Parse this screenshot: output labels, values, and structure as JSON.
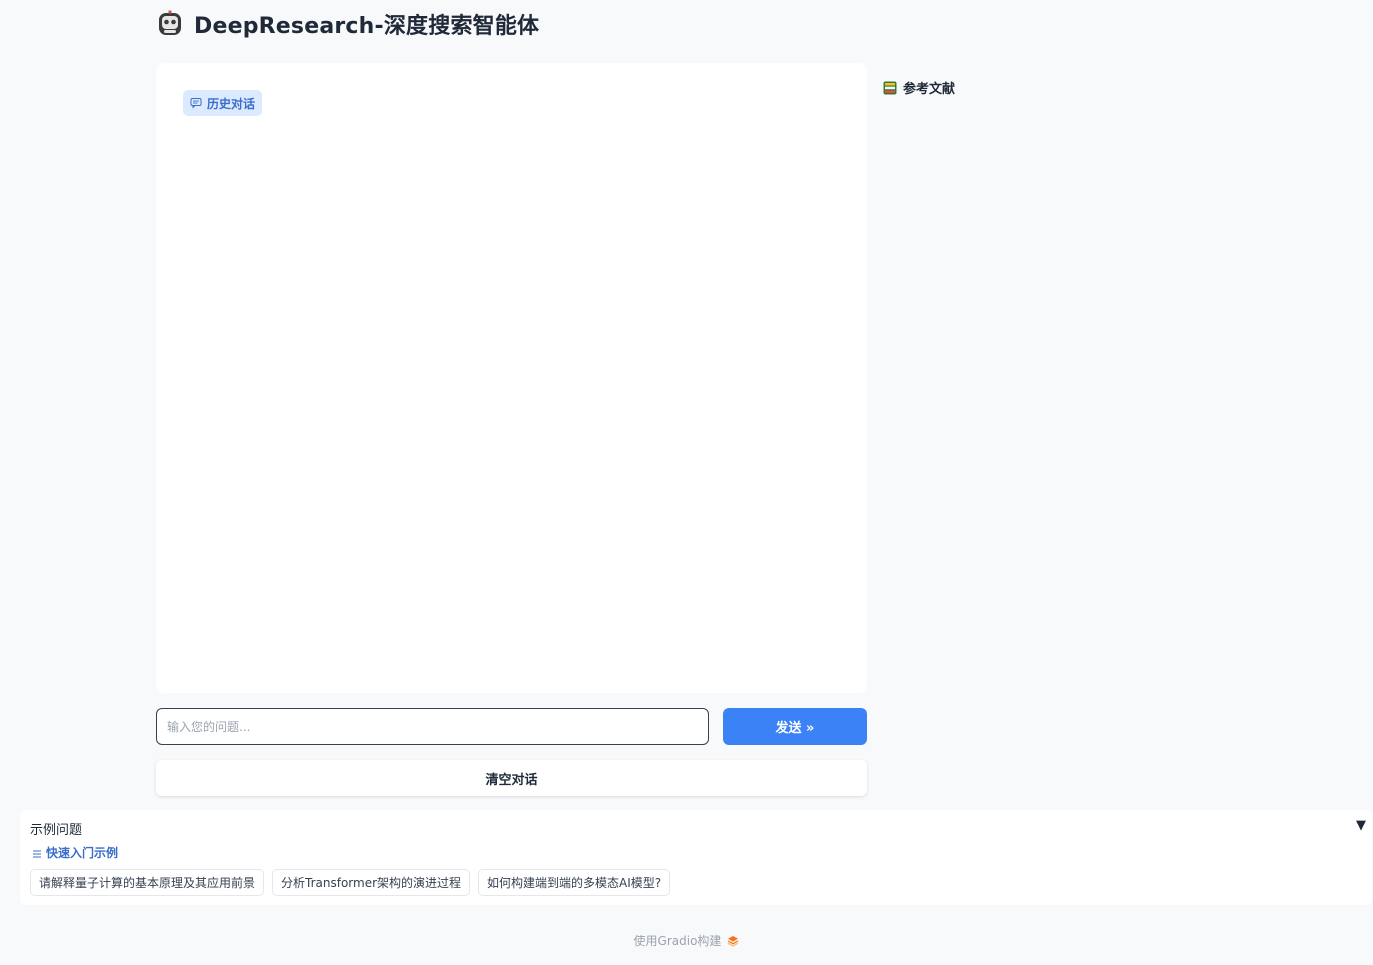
{
  "header": {
    "title": "DeepResearch-深度搜索智能体",
    "icon": "robot-icon"
  },
  "chat": {
    "history_label": "历史对话",
    "history_icon": "chat-bubble-icon"
  },
  "references": {
    "label": "参考文献",
    "icon": "book-icon"
  },
  "input": {
    "placeholder": "输入您的问题...",
    "value": ""
  },
  "send_button": {
    "label": "发送 »"
  },
  "clear_button": {
    "label": "清空对话"
  },
  "examples": {
    "title": "示例问题",
    "collapse_glyph": "▼",
    "quickstart_label": "快速入门示例",
    "items": [
      "请解释量子计算的基本原理及其应用前景",
      "分析Transformer架构的演进过程",
      "如何构建端到端的多模态AI模型?"
    ]
  },
  "footer": {
    "label": "使用Gradio构建",
    "icon": "gradio-logo-icon"
  },
  "colors": {
    "accent": "#3b82f6",
    "badge_bg": "#dbeafe",
    "badge_text": "#3b6ec9",
    "background": "#f8f9fb"
  }
}
